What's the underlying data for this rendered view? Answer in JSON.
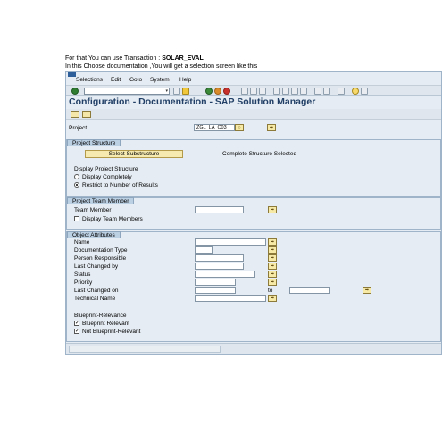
{
  "intro": {
    "line1_prefix": "For that You can use Transaction  :  ",
    "line1_tcode": "SOLAR_EVAL",
    "line2": "In this Choose documentation ,You will get a selection screen like this"
  },
  "menubar": [
    "Selections",
    "Edit",
    "Goto",
    "System",
    "Help"
  ],
  "window_title": "Configuration - Documentation - SAP Solution Manager",
  "project": {
    "label": "Project",
    "value": "ZGL_LA_C03"
  },
  "structure": {
    "header": "Project Structure",
    "select_button": "Select Substructure",
    "complete_text": "Complete Structure Selected",
    "display_label": "Display Project Structure",
    "option_complete": "Display Completely",
    "option_restrict": "Restrict to Number of Results",
    "selected_option": "restrict"
  },
  "team": {
    "header": "Project Team Member",
    "member_label": "Team Member",
    "display_label": "Display Team Members",
    "display_checked": false
  },
  "attributes": {
    "header": "Object Attributes",
    "fields": [
      "Name",
      "Documentation Type",
      "Person Responsible",
      "Last Changed by",
      "Status",
      "Priority",
      "Last Changed on",
      "Technical Name"
    ],
    "to_label": "to",
    "relevance_label": "Blueprint-Relevance",
    "relevant_label": "Blueprint Relevant",
    "relevant_checked": true,
    "not_relevant_label": "Not Blueprint-Relevant",
    "not_relevant_checked": true
  },
  "icons": {
    "enter": "enter-check-icon",
    "back": "back-icon",
    "exit": "exit-icon",
    "cancel": "cancel-icon",
    "help": "help-icon",
    "execute": "execute-icon",
    "search_help": "search-help-icon",
    "multiple_selection": "multiple-selection-arrow-icon"
  },
  "colors": {
    "title": "#213f66",
    "group_header": "#bcd0e4",
    "window_bg": "#e5ecf3",
    "button": "#f6eab0"
  }
}
